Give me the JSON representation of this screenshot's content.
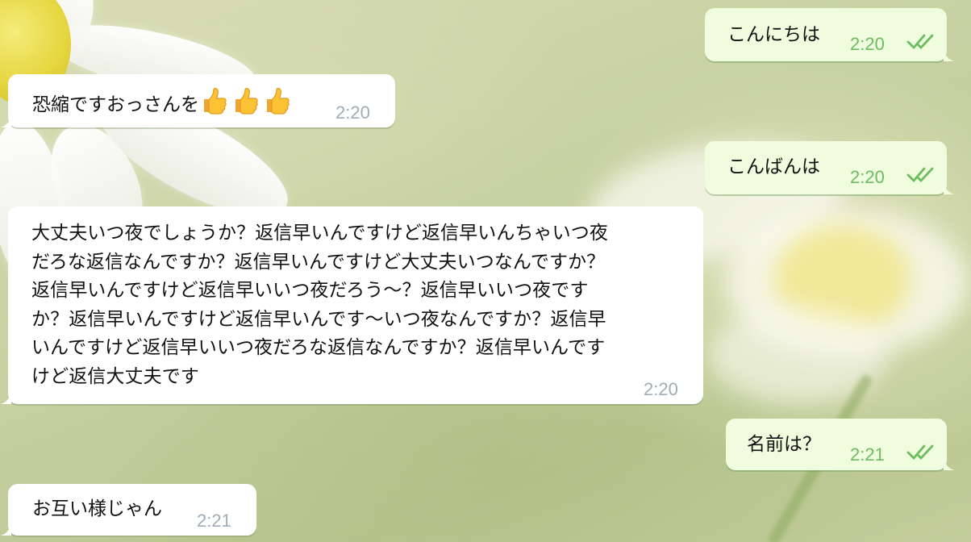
{
  "messages": [
    {
      "id": "m1",
      "direction": "out",
      "text": "こんにちは",
      "time": "2:20",
      "status": "read"
    },
    {
      "id": "m2",
      "direction": "in",
      "text": "恐縮ですおっさんを",
      "emoji": [
        "thumbs-up",
        "thumbs-up",
        "thumbs-up"
      ],
      "time": "2:20"
    },
    {
      "id": "m3",
      "direction": "out",
      "text": "こんばんは",
      "time": "2:20",
      "status": "read"
    },
    {
      "id": "m4",
      "direction": "in",
      "lines": [
        "大丈夫いつ夜でしょうか？返信早いんですけど返信早いんちゃいつ夜",
        "だろな返信なんですか？返信早いんですけど大丈夫いつなんですか？",
        "返信早いんですけど返信早いいつ夜だろう〜？返信早いいつ夜です",
        "か？返信早いんですけど返信早いんです〜いつ夜なんですか？返信早",
        "いんですけど返信早いいつ夜だろな返信なんですか？返信早いんです",
        "けど返信大丈夫です"
      ],
      "time": "2:20"
    },
    {
      "id": "m5",
      "direction": "out",
      "text": "名前は？",
      "time": "2:21",
      "status": "read"
    },
    {
      "id": "m6",
      "direction": "in",
      "text": "お互い様じゃん",
      "time": "2:21"
    }
  ],
  "colors": {
    "incoming_bubble": "#ffffff",
    "outgoing_bubble": "#effdde",
    "incoming_time": "#a0acb6",
    "outgoing_time": "#6cbd60",
    "read_check": "#6cbd60"
  },
  "icons": {
    "read_status": "double-check-icon",
    "emoji": "thumbs-up-emoji"
  }
}
